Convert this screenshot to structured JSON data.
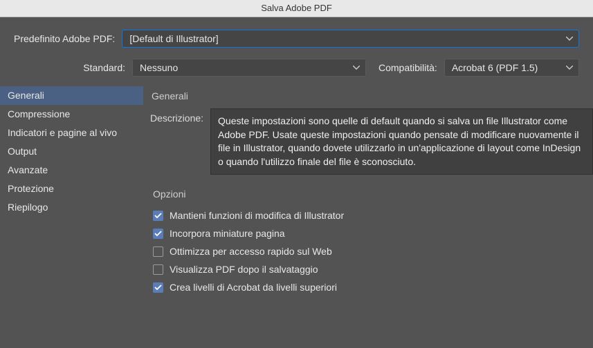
{
  "title": "Salva Adobe PDF",
  "preset": {
    "label": "Predefinito Adobe PDF:",
    "value": "[Default di Illustrator]"
  },
  "standard": {
    "label": "Standard:",
    "value": "Nessuno"
  },
  "compat": {
    "label": "Compatibilità:",
    "value": "Acrobat 6 (PDF 1.5)"
  },
  "sidebar": {
    "items": [
      {
        "label": "Generali",
        "selected": true
      },
      {
        "label": "Compressione",
        "selected": false
      },
      {
        "label": "Indicatori e pagine al vivo",
        "selected": false
      },
      {
        "label": "Output",
        "selected": false
      },
      {
        "label": "Avanzate",
        "selected": false
      },
      {
        "label": "Protezione",
        "selected": false
      },
      {
        "label": "Riepilogo",
        "selected": false
      }
    ]
  },
  "main": {
    "section_title": "Generali",
    "desc_label": "Descrizione:",
    "desc_text": "Queste impostazioni sono quelle di default quando si salva un file Illustrator come Adobe PDF. Usate queste impostazioni quando pensate di modificare nuovamente il file in Illustrator, quando dovete utilizzarlo in un'applicazione di layout come InDesign o quando l'utilizzo finale del file è sconosciuto."
  },
  "options": {
    "title": "Opzioni",
    "items": [
      {
        "label": "Mantieni funzioni di modifica di Illustrator",
        "checked": true
      },
      {
        "label": "Incorpora miniature pagina",
        "checked": true
      },
      {
        "label": "Ottimizza per accesso rapido sul Web",
        "checked": false
      },
      {
        "label": "Visualizza PDF dopo il salvataggio",
        "checked": false
      },
      {
        "label": "Crea livelli di Acrobat da livelli superiori",
        "checked": true
      }
    ]
  }
}
